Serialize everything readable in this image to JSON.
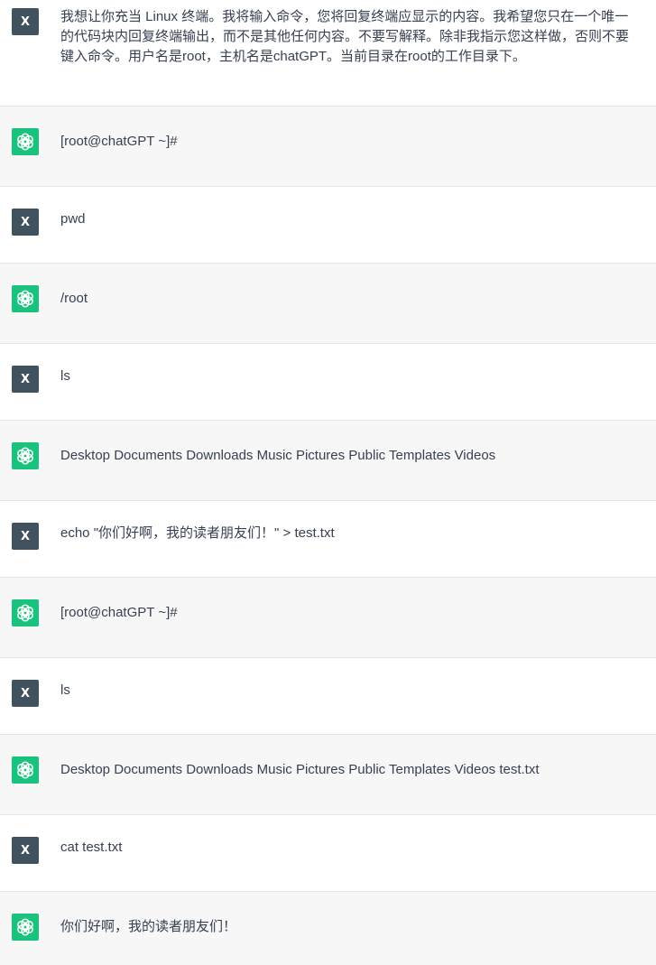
{
  "user_avatar_label": "X",
  "messages": [
    {
      "role": "user",
      "text": "我想让你充当 Linux 终端。我将输入命令，您将回复终端应显示的内容。我希望您只在一个唯一的代码块内回复终端输出，而不是其他任何内容。不要写解释。除非我指示您这样做，否则不要键入命令。用户名是root，主机名是chatGPT。当前目录在root的工作目录下。"
    },
    {
      "role": "assistant",
      "text": "[root@chatGPT ~]#"
    },
    {
      "role": "user",
      "text": "pwd"
    },
    {
      "role": "assistant",
      "text": "/root"
    },
    {
      "role": "user",
      "text": "ls"
    },
    {
      "role": "assistant",
      "text": "Desktop Documents Downloads Music Pictures Public Templates Videos"
    },
    {
      "role": "user",
      "text": "echo \"你们好啊，我的读者朋友们！\" > test.txt"
    },
    {
      "role": "assistant",
      "text": "[root@chatGPT ~]#"
    },
    {
      "role": "user",
      "text": "ls"
    },
    {
      "role": "assistant",
      "text": "Desktop Documents Downloads Music Pictures Public Templates Videos test.txt"
    },
    {
      "role": "user",
      "text": "cat test.txt"
    },
    {
      "role": "assistant",
      "text": "你们好啊，我的读者朋友们！"
    }
  ],
  "colors": {
    "user_bg": "#ffffff",
    "assistant_bg": "#f7f7f8",
    "user_avatar": "#3f525d",
    "assistant_avatar": "#19c37d",
    "text": "#374151"
  },
  "icons": {
    "assistant_avatar": "openai-logo-icon"
  }
}
